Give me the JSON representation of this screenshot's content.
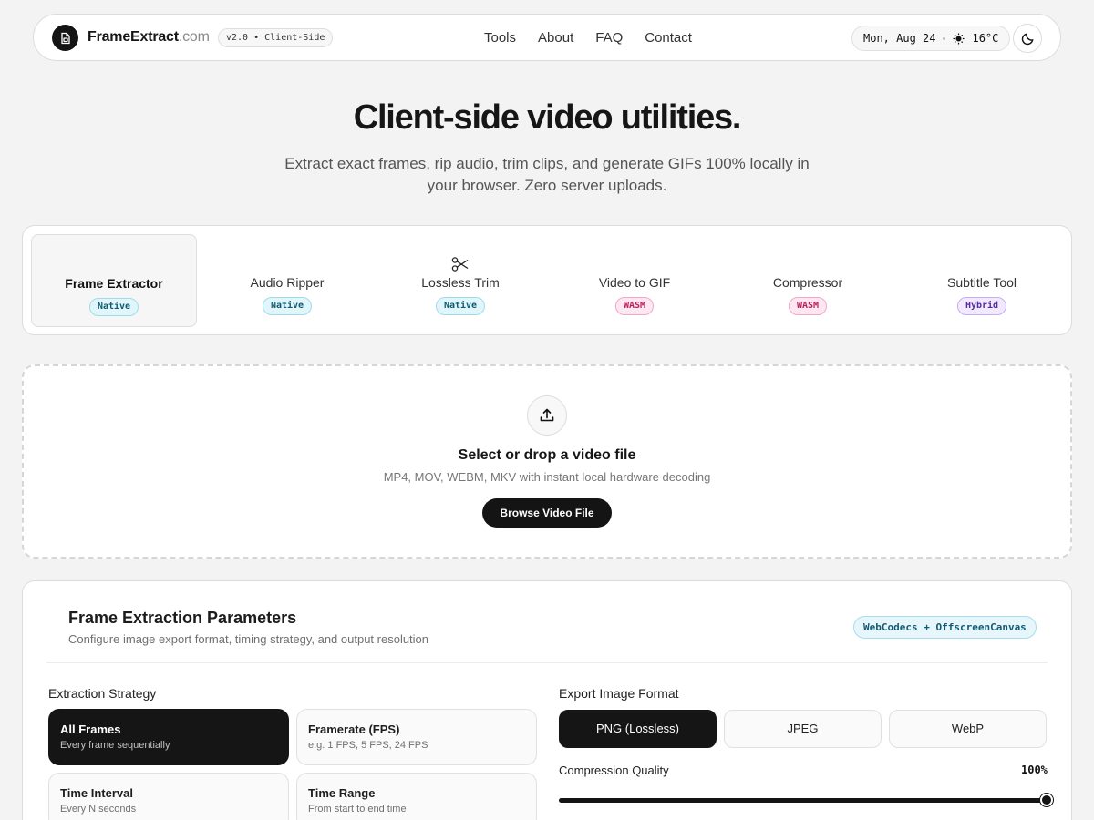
{
  "header": {
    "brand_name": "FrameExtract",
    "brand_tld": ".com",
    "version": "v2.0 • Client-Side",
    "nav": [
      "Tools",
      "About",
      "FAQ",
      "Contact"
    ],
    "date": "Mon, Aug 24",
    "weather_icon": "sun-icon",
    "temperature": "16°C",
    "theme_icon": "moon-icon"
  },
  "hero": {
    "title": "Client-side video utilities.",
    "subtitle": "Extract exact frames, rip audio, trim clips, and generate GIFs 100% locally in your browser. Zero server uploads."
  },
  "tools": [
    {
      "label": "Frame Extractor",
      "badge": "Native",
      "badge_type": "native",
      "active": true,
      "icon": null
    },
    {
      "label": "Audio Ripper",
      "badge": "Native",
      "badge_type": "native",
      "active": false,
      "icon": null
    },
    {
      "label": "Lossless Trim",
      "badge": "Native",
      "badge_type": "native",
      "active": false,
      "icon": "scissors-icon"
    },
    {
      "label": "Video to GIF",
      "badge": "WASM",
      "badge_type": "wasm",
      "active": false,
      "icon": null
    },
    {
      "label": "Compressor",
      "badge": "WASM",
      "badge_type": "wasm",
      "active": false,
      "icon": null
    },
    {
      "label": "Subtitle Tool",
      "badge": "Hybrid",
      "badge_type": "hybrid",
      "active": false,
      "icon": null
    }
  ],
  "dropzone": {
    "icon": "upload-icon",
    "title": "Select or drop a video file",
    "subtitle": "MP4, MOV, WEBM, MKV with instant local hardware decoding",
    "button": "Browse Video File"
  },
  "params": {
    "title": "Frame Extraction Parameters",
    "subtitle": "Configure image export format, timing strategy, and output resolution",
    "engine": "WebCodecs + OffscreenCanvas",
    "strategy_label": "Extraction Strategy",
    "strategies": [
      {
        "name": "All Frames",
        "desc": "Every frame sequentially",
        "active": true
      },
      {
        "name": "Framerate (FPS)",
        "desc": "e.g. 1 FPS, 5 FPS, 24 FPS",
        "active": false
      },
      {
        "name": "Time Interval",
        "desc": "Every N seconds",
        "active": false
      },
      {
        "name": "Time Range",
        "desc": "From start to end time",
        "active": false
      }
    ],
    "format_label": "Export Image Format",
    "formats": [
      {
        "label": "PNG (Lossless)",
        "active": true
      },
      {
        "label": "JPEG",
        "active": false
      },
      {
        "label": "WebP",
        "active": false
      }
    ],
    "quality_label": "Compression Quality",
    "quality_value": "100%",
    "quality_fraction": 1.0
  }
}
